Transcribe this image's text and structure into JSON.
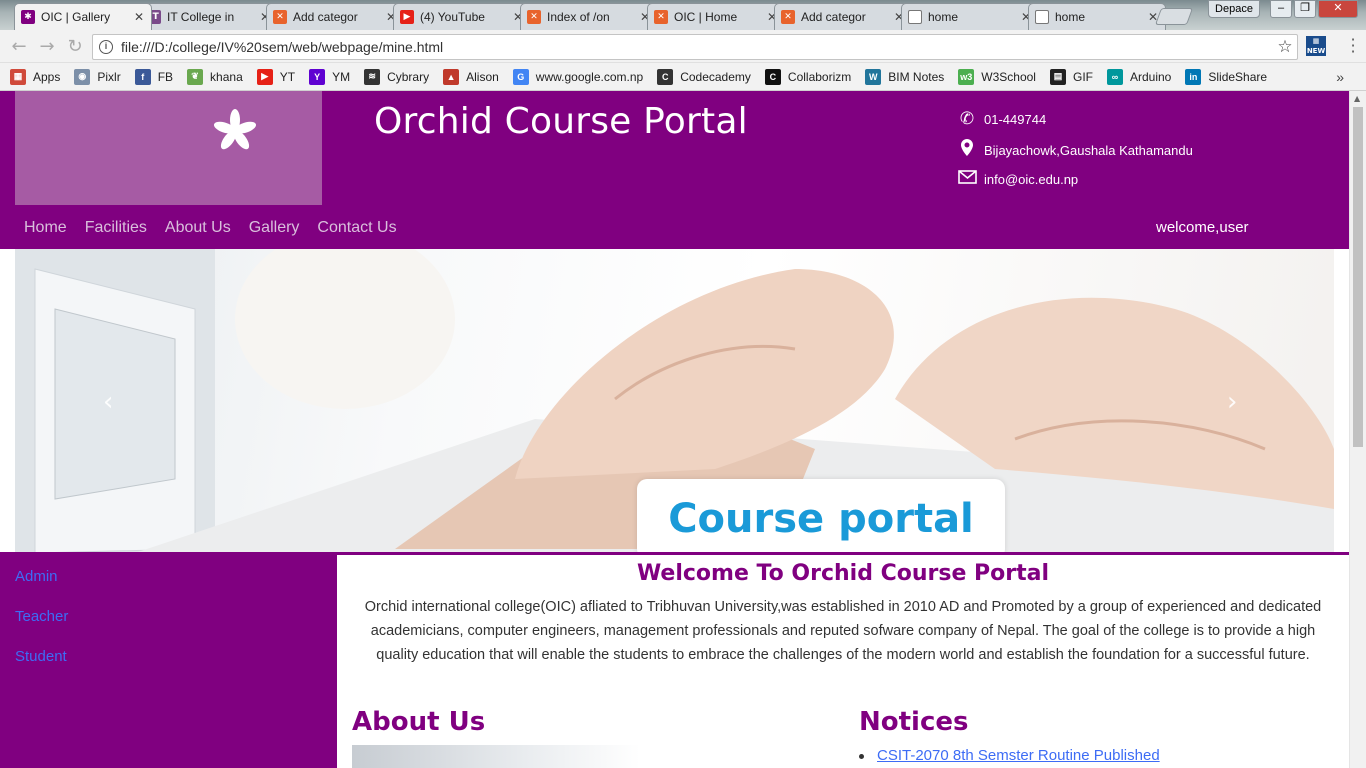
{
  "browser": {
    "tabs": [
      {
        "title": "OIC | Gallery",
        "favicon": "purple-flower-icon",
        "color": "#800080",
        "active": true
      },
      {
        "title": "IT College in",
        "favicon": "college-logo-icon",
        "color": "#7a4a8a"
      },
      {
        "title": "Add categor",
        "favicon": "xampp-icon",
        "color": "#e8632c"
      },
      {
        "title": "(4) YouTube",
        "favicon": "youtube-icon",
        "color": "#e62117"
      },
      {
        "title": "Index of /on",
        "favicon": "xampp-icon",
        "color": "#e8632c"
      },
      {
        "title": "OIC | Home",
        "favicon": "xampp-icon",
        "color": "#e8632c"
      },
      {
        "title": "Add categor",
        "favicon": "xampp-icon",
        "color": "#e8632c"
      },
      {
        "title": "home",
        "favicon": "page-icon",
        "color": "#ffffff"
      },
      {
        "title": "home",
        "favicon": "page-icon",
        "color": "#ffffff"
      }
    ],
    "window_label": "Depace",
    "url": "file:///D:/college/IV%20sem/web/webpage/mine.html",
    "bookmarks": [
      {
        "label": "Apps",
        "icon": "apps-grid-icon",
        "color": "#d04a3b"
      },
      {
        "label": "Pixlr",
        "icon": "pixlr-icon",
        "color": "#7c8fa8"
      },
      {
        "label": "FB",
        "icon": "facebook-icon",
        "color": "#3b5998"
      },
      {
        "label": "khana",
        "icon": "leaf-icon",
        "color": "#6aa84f"
      },
      {
        "label": "YT",
        "icon": "youtube-icon",
        "color": "#e62117"
      },
      {
        "label": "YM",
        "icon": "yahoo-icon",
        "color": "#5f01d1"
      },
      {
        "label": "Cybrary",
        "icon": "cybrary-icon",
        "color": "#333333"
      },
      {
        "label": "Alison",
        "icon": "alison-icon",
        "color": "#c0392b"
      },
      {
        "label": "www.google.com.np",
        "icon": "google-icon",
        "color": "#4285f4"
      },
      {
        "label": "Codecademy",
        "icon": "codecademy-icon",
        "color": "#333333"
      },
      {
        "label": "Collaborizm",
        "icon": "collaborizm-icon",
        "color": "#111111"
      },
      {
        "label": "BIM Notes",
        "icon": "wordpress-icon",
        "color": "#21759b"
      },
      {
        "label": "W3School",
        "icon": "w3schools-icon",
        "color": "#4caf50"
      },
      {
        "label": "GIF",
        "icon": "gif-icon",
        "color": "#222222"
      },
      {
        "label": "Arduino",
        "icon": "arduino-icon",
        "color": "#00979c"
      },
      {
        "label": "SlideShare",
        "icon": "linkedin-icon",
        "color": "#0077b5"
      }
    ]
  },
  "site": {
    "brand_color": "#800080",
    "title": "Orchid Course Portal",
    "contact": {
      "phone": "01-449744",
      "address": "Bijayachowk,Gaushala Kathamandu",
      "email": "info@oic.edu.np"
    },
    "nav": [
      "Home",
      "Facilities",
      "About Us",
      "Gallery",
      "Contact Us"
    ],
    "welcome_user": "welcome,user",
    "carousel": {
      "caption": "Course portal",
      "prev_label": "‹",
      "next_label": "›"
    },
    "sidebar": [
      "Admin",
      "Teacher",
      "Student"
    ],
    "welcome_heading": "Welcome To Orchid Course Portal",
    "intro": "Orchid international college(OIC) afliated to Tribhuvan University,was established in 2010 AD and Promoted by a group of experienced and dedicated academicians, computer engineers, management professionals and reputed sofware company of Nepal. The goal of the college is to provide a high quality education that will enable the students to embrace the challenges of the modern world and establish the foundation for a successful future.",
    "about_heading": "About Us",
    "notices_heading": "Notices",
    "notices": [
      "CSIT-2070 8th Semster Routine Published"
    ]
  }
}
